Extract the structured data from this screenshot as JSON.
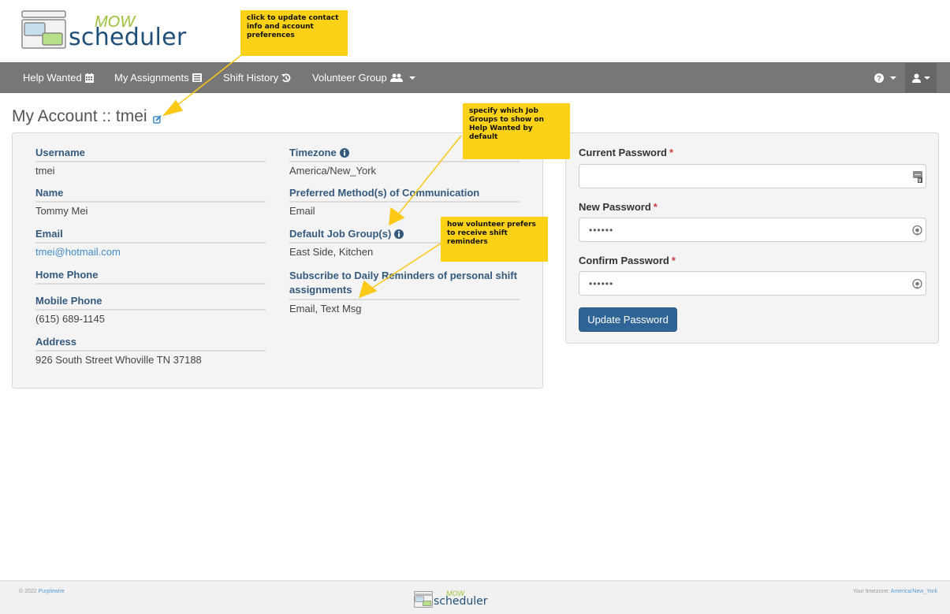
{
  "brand": {
    "mow": "MOW",
    "word": "scheduler"
  },
  "nav": {
    "items": [
      {
        "label": "Help Wanted",
        "icon": "calendar-icon"
      },
      {
        "label": "My Assignments",
        "icon": "list-alt-icon"
      },
      {
        "label": "Shift History",
        "icon": "history-icon"
      },
      {
        "label": "Volunteer Group",
        "icon": "users-icon",
        "dropdown": true
      }
    ],
    "help_icon": "question-circle-icon",
    "user_icon": "user-icon"
  },
  "page": {
    "title": "My Account :: tmei",
    "edit_icon": "edit-icon"
  },
  "account": {
    "left": [
      {
        "label": "Username",
        "value": "tmei"
      },
      {
        "label": "Name",
        "value": "Tommy Mei"
      },
      {
        "label": "Email",
        "value": "tmei@hotmail.com",
        "link": true
      },
      {
        "label": "Home Phone",
        "value": ""
      },
      {
        "label": "Mobile Phone",
        "value": "(615) 689-1145"
      },
      {
        "label": "Address",
        "value": "926 South Street Whoville TN 37188"
      }
    ],
    "right": [
      {
        "label": "Timezone",
        "value": "America/New_York",
        "info": true
      },
      {
        "label": "Preferred Method(s) of Communication",
        "value": "Email"
      },
      {
        "label": "Default Job Group(s)",
        "value": "East Side, Kitchen",
        "info": true
      },
      {
        "label": "Subscribe to Daily Reminders of personal shift assignments",
        "value": "Email, Text Msg"
      }
    ]
  },
  "password_form": {
    "current_label": "Current Password",
    "current_value": "",
    "new_label": "New Password",
    "new_value": "••••••",
    "confirm_label": "Confirm Password",
    "confirm_value": "••••••",
    "required_mark": "*",
    "submit_label": "Update Password"
  },
  "callouts": {
    "edit": "click to update contact info and account preferences",
    "job_groups": "specify which Job Groups to show on Help Wanted by default",
    "reminders": "how volunteer prefers to receive shift reminders"
  },
  "footer": {
    "copyright": "© 2022",
    "company": "Purplewire",
    "timezone_label": "Your timezone:",
    "timezone_value": "America/New_York"
  },
  "colors": {
    "navbar": "#777777",
    "primary": "#2f6497",
    "label": "#345a7e",
    "link": "#428bca",
    "callout": "#fcd116"
  }
}
